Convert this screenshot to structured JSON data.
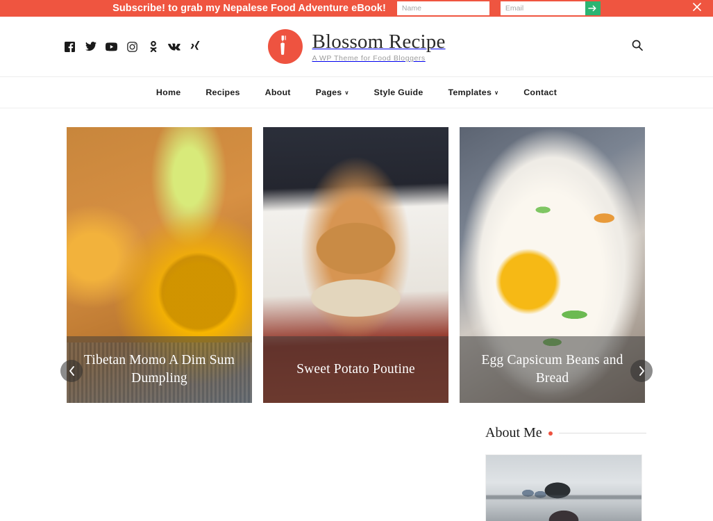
{
  "subscribe_bar": {
    "message": "Subscribe! to grab my Nepalese Food Adventure eBook!",
    "name_placeholder": "Name",
    "name_value": "",
    "email_placeholder": "Email",
    "email_value": "",
    "submit_label": "",
    "close_label": "",
    "background_color": "#ef5540",
    "submit_color": "#2cb472"
  },
  "header": {
    "brand_title": "Blossom Recipe",
    "brand_tagline": "A WP Theme for Food Bloggers",
    "brand_color": "#ee5340",
    "search_label": "",
    "social": [
      {
        "name": "facebook",
        "label": "Facebook"
      },
      {
        "name": "twitter",
        "label": "Twitter"
      },
      {
        "name": "youtube",
        "label": "YouTube"
      },
      {
        "name": "instagram",
        "label": "Instagram"
      },
      {
        "name": "odnoklassniki",
        "label": "Odnoklassniki"
      },
      {
        "name": "vk",
        "label": "VK"
      },
      {
        "name": "xing",
        "label": "Xing"
      }
    ]
  },
  "nav": {
    "items": [
      {
        "label": "Home",
        "has_dropdown": false
      },
      {
        "label": "Recipes",
        "has_dropdown": false
      },
      {
        "label": "About",
        "has_dropdown": false
      },
      {
        "label": "Pages",
        "has_dropdown": true
      },
      {
        "label": "Style Guide",
        "has_dropdown": false
      },
      {
        "label": "Templates",
        "has_dropdown": true
      },
      {
        "label": "Contact",
        "has_dropdown": false
      }
    ],
    "caret_glyph": "∨"
  },
  "slider": {
    "prev_label": "‹",
    "next_label": "›",
    "slides": [
      {
        "title": "Tibetan Momo A Dim Sum Dumpling",
        "photo": "passion-fruit-juice-with-lime"
      },
      {
        "title": "Sweet Potato Poutine",
        "photo": "sesame-burger-in-takeout-box"
      },
      {
        "title": "Egg Capsicum Beans and Bread",
        "photo": "fried-egg-bowl-with-scallions"
      }
    ]
  },
  "lower": {
    "post_photo": "blurred-dried-flowers-pink",
    "about_widget": {
      "title": "About Me",
      "accent_color": "#ee5340",
      "photo": "kitchen-person-back-view"
    }
  }
}
